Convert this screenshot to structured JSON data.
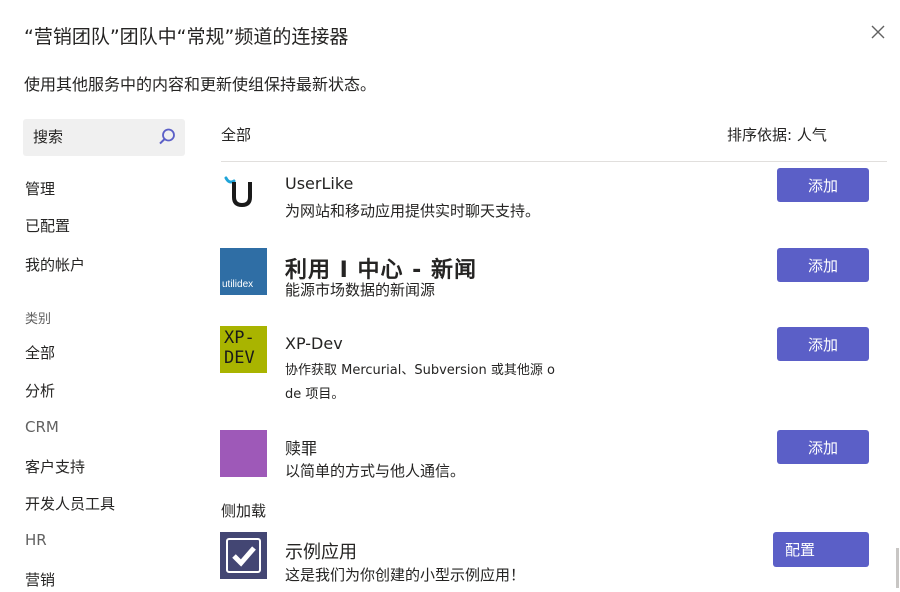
{
  "dialog": {
    "title": "“营销团队”团队中“常规”频道的连接器",
    "subtitle": "使用其他服务中的内容和更新使组保持最新状态。",
    "close_icon": "close-icon"
  },
  "sidebar": {
    "search_placeholder": "搜索",
    "manage_items": [
      "管理",
      "已配置",
      "我的帐户"
    ],
    "category_heading": "类别",
    "categories": [
      "全部",
      "分析",
      "CRM",
      "客户支持",
      "开发人员工具",
      "HR",
      "营销"
    ]
  },
  "list": {
    "header_left": "全部",
    "sort_label": "排序依据: 人气",
    "connectors": [
      {
        "name": "UserLike",
        "description": "为网站和移动应用提供实时聊天支持。",
        "button": "添加",
        "icon": "userlike-logo-icon"
      },
      {
        "name": "利用 I 中心 - 新闻",
        "description": "能源市场数据的新闻源",
        "button": "添加",
        "icon": "utilidex-logo-icon",
        "logo_text": "utilidex"
      },
      {
        "name": "XP-Dev",
        "description_line1": "协作获取 Mercurial、Subversion 或其他源 o",
        "description_line2": "de 项目。",
        "button": "添加",
        "icon": "xp-dev-logo-icon",
        "logo_text_1": "XP-",
        "logo_text_2": "DEV"
      },
      {
        "name": "赎罪",
        "description": "以简单的方式与他人通信。",
        "button": "添加",
        "icon": "purple-square-icon"
      }
    ],
    "sideload_label": "侧加载",
    "sideloaded": {
      "name": "示例应用",
      "description": "这是我们为你创建的小型示例应用！",
      "button": "配置",
      "icon": "checkmark-icon"
    }
  },
  "colors": {
    "accent": "#5b5fc7",
    "utilidex": "#2f6ea5",
    "xpdev": "#a9b400",
    "purple": "#9e59b8",
    "checkmark_bg": "#434673"
  }
}
